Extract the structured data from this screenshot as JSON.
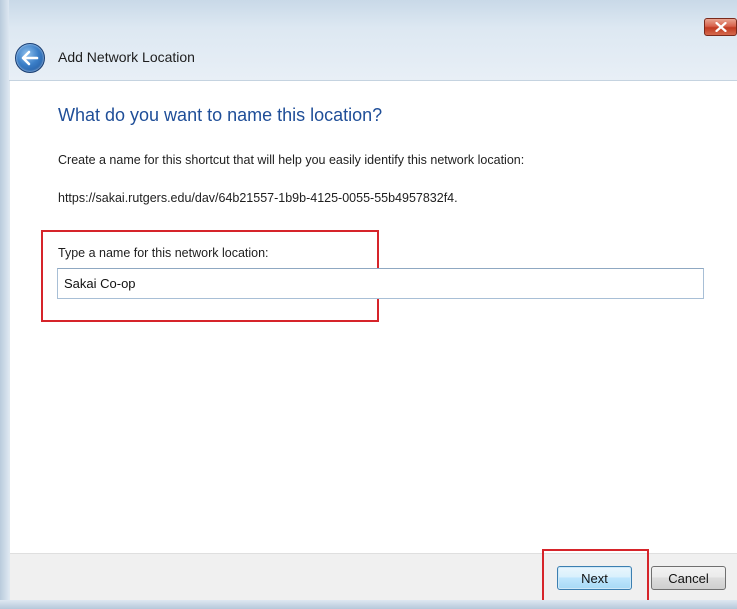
{
  "window": {
    "title": "Add Network Location"
  },
  "page": {
    "heading": "What do you want to name this location?",
    "description": "Create a name for this shortcut that will help you easily identify this network location:",
    "url": "https://sakai.rutgers.edu/dav/64b21557-1b9b-4125-0055-55b4957832f4.",
    "field_label": "Type a name for this network location:",
    "name_value": "Sakai Co-op"
  },
  "footer": {
    "next_label": "Next",
    "cancel_label": "Cancel"
  },
  "icons": {
    "back": "back-arrow-icon",
    "close": "close-icon"
  },
  "colors": {
    "heading": "#1f4e98",
    "highlight": "#d6242a",
    "close_button": "#c13b22"
  }
}
